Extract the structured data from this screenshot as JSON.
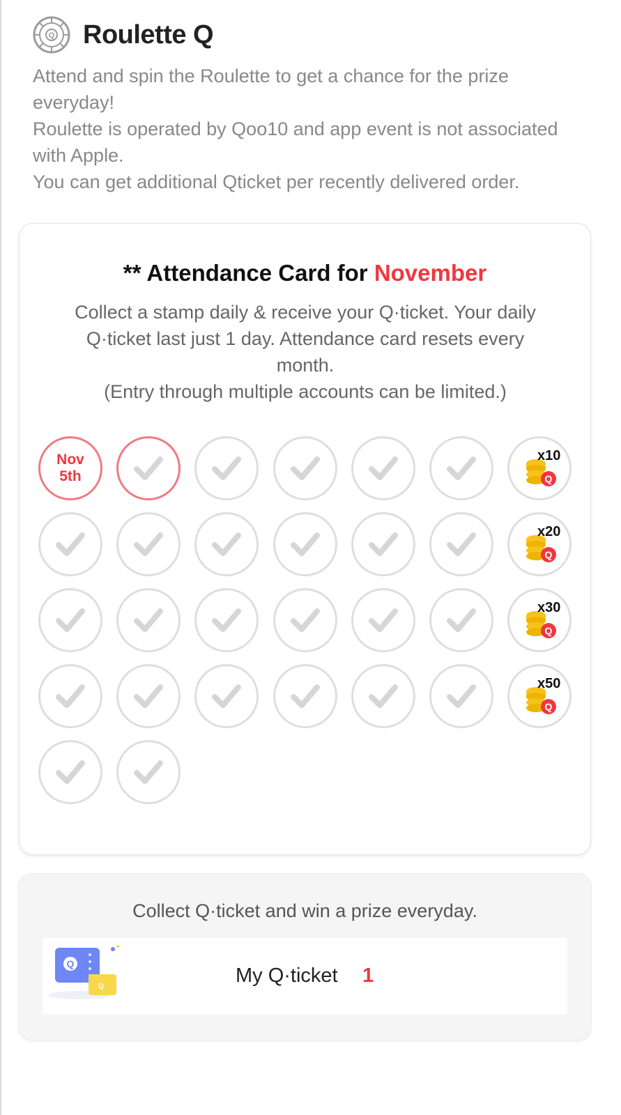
{
  "header": {
    "title": "Roulette Q",
    "logo_icon": "roulette-icon"
  },
  "description": [
    "Attend and spin the Roulette to get a chance for the prize everyday!",
    "Roulette is operated by Qoo10 and app event is not associated with Apple.",
    "You can get additional Qticket per recently delivered order."
  ],
  "card": {
    "title_prefix": "** Attendance Card for ",
    "title_month": "November",
    "desc_line1": "Collect a stamp daily & receive your Q·ticket. Your daily Q·ticket last just 1 day. Attendance card resets every month.",
    "desc_line2": "(Entry through multiple accounts can be limited.)",
    "today_label_line1": "Nov",
    "today_label_line2": "5th",
    "rewards": [
      "x10",
      "x20",
      "x30",
      "x50"
    ],
    "accent_color": "#f0373f"
  },
  "bottom": {
    "text": "Collect Q·ticket and win a prize everyday.",
    "ticket_label": "My Q·ticket",
    "ticket_count": "1"
  }
}
